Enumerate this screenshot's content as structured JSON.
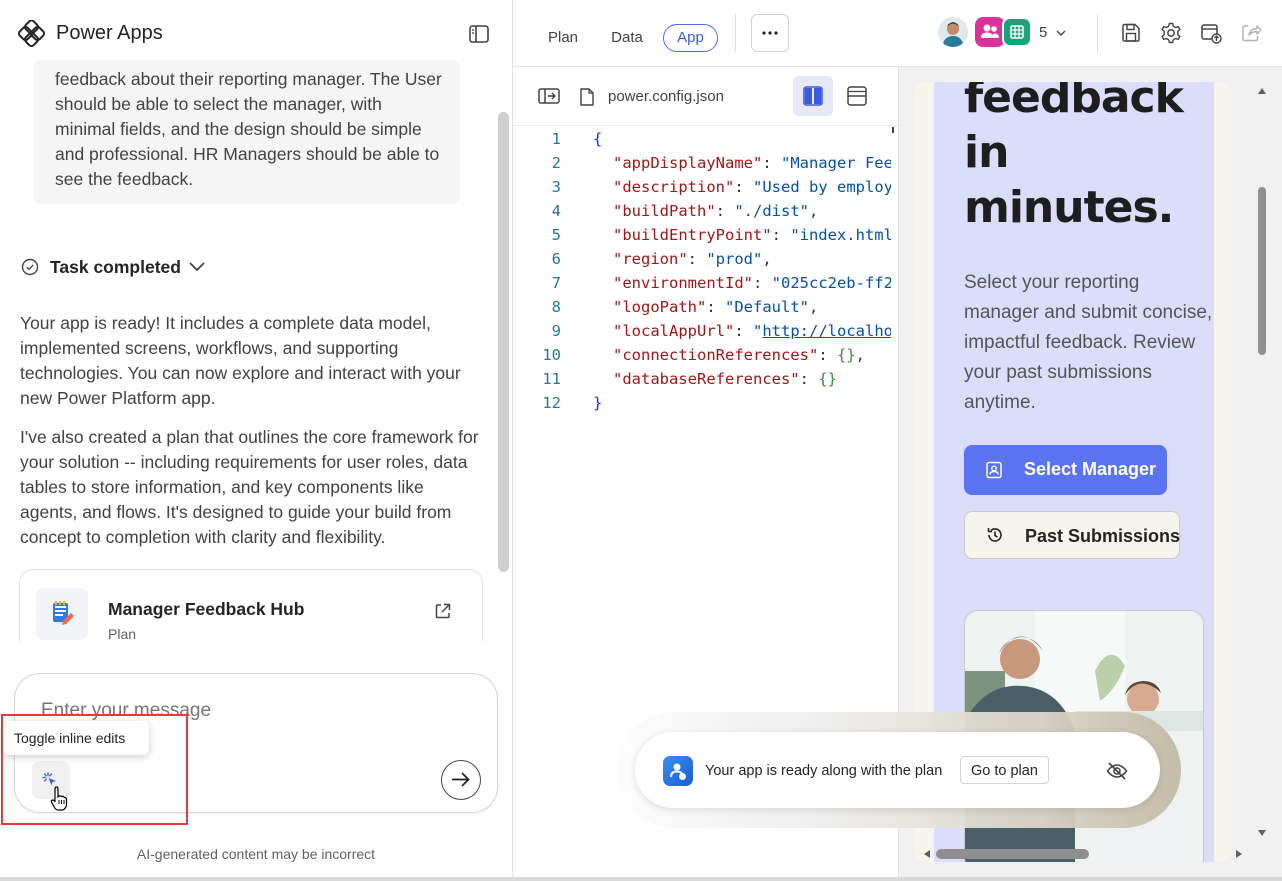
{
  "app": {
    "title": "Power Apps"
  },
  "chat": {
    "prompt_text": "feedback about their reporting manager. The User should be able to select the manager, with minimal fields, and the design should be simple and professional. HR Managers should be able to see the feedback.",
    "task_status": "Task completed",
    "response_1": "Your app is ready! It includes a complete data model, implemented screens, workflows, and supporting technologies. You can now explore and interact with your new Power Platform app.",
    "response_2": "I've also created a plan that outlines the core framework for your solution -- including requirements for user roles, data tables to store information, and key components like agents, and flows. It's designed to guide your build from concept to completion with clarity and flexibility.",
    "plan_card": {
      "title": "Manager Feedback Hub",
      "subtitle": "Plan"
    },
    "input_placeholder": "Enter your message",
    "tooltip": "Toggle inline edits",
    "disclaimer": "AI-generated content may be incorrect"
  },
  "topbar": {
    "tabs": [
      {
        "label": "Plan",
        "active": false
      },
      {
        "label": "Data",
        "active": false
      },
      {
        "label": "App",
        "active": true
      }
    ],
    "collaborators_count": "5"
  },
  "code_editor": {
    "filename": "power.config.json",
    "line_numbers": [
      "1",
      "2",
      "3",
      "4",
      "5",
      "6",
      "7",
      "8",
      "9",
      "10",
      "11",
      "12"
    ],
    "lines": [
      [
        {
          "t": "{",
          "c": "b"
        }
      ],
      [
        {
          "t": "\"appDisplayName\"",
          "c": "k"
        },
        {
          "t": ": ",
          "c": "p"
        },
        {
          "t": "\"Manager Fee",
          "c": "s"
        }
      ],
      [
        {
          "t": "\"description\"",
          "c": "k"
        },
        {
          "t": ": ",
          "c": "p"
        },
        {
          "t": "\"Used by employ",
          "c": "s"
        }
      ],
      [
        {
          "t": "\"buildPath\"",
          "c": "k"
        },
        {
          "t": ": ",
          "c": "p"
        },
        {
          "t": "\"./dist\"",
          "c": "s"
        },
        {
          "t": ",",
          "c": "p"
        }
      ],
      [
        {
          "t": "\"buildEntryPoint\"",
          "c": "k"
        },
        {
          "t": ": ",
          "c": "p"
        },
        {
          "t": "\"index.html",
          "c": "s"
        }
      ],
      [
        {
          "t": "\"region\"",
          "c": "k"
        },
        {
          "t": ": ",
          "c": "p"
        },
        {
          "t": "\"prod\"",
          "c": "s"
        },
        {
          "t": ",",
          "c": "p"
        }
      ],
      [
        {
          "t": "\"environmentId\"",
          "c": "k"
        },
        {
          "t": ": ",
          "c": "p"
        },
        {
          "t": "\"025cc2eb-ff2",
          "c": "s"
        }
      ],
      [
        {
          "t": "\"logoPath\"",
          "c": "k"
        },
        {
          "t": ": ",
          "c": "p"
        },
        {
          "t": "\"Default\"",
          "c": "s"
        },
        {
          "t": ",",
          "c": "p"
        }
      ],
      [
        {
          "t": "\"localAppUrl\"",
          "c": "k"
        },
        {
          "t": ": ",
          "c": "p"
        },
        {
          "t": "\"",
          "c": "s"
        },
        {
          "t": "http://localho",
          "c": "u"
        }
      ],
      [
        {
          "t": "\"connectionReferences\"",
          "c": "k"
        },
        {
          "t": ": ",
          "c": "p"
        },
        {
          "t": "{}",
          "c": "g"
        },
        {
          "t": ",",
          "c": "p"
        }
      ],
      [
        {
          "t": "\"databaseReferences\"",
          "c": "k"
        },
        {
          "t": ": ",
          "c": "p"
        },
        {
          "t": "{}",
          "c": "g"
        }
      ],
      [
        {
          "t": "}",
          "c": "b"
        }
      ]
    ],
    "indent": [
      false,
      true,
      true,
      true,
      true,
      true,
      true,
      true,
      true,
      true,
      true,
      false
    ]
  },
  "preview": {
    "hero_lines": [
      "feedback",
      "in",
      "minutes."
    ],
    "hero_sub": "Select your reporting manager and submit concise, impactful feedback. Review your past submissions anytime.",
    "primary_button": "Select Manager",
    "secondary_button": "Past Submissions"
  },
  "toast": {
    "message": "Your app is ready along with the plan",
    "action": "Go to plan"
  },
  "colors": {
    "accent": "#4f6bed",
    "preview_bg": "#dcdcfb",
    "primary_button": "#5a73ef",
    "highlight_box": "#e03c3c"
  }
}
